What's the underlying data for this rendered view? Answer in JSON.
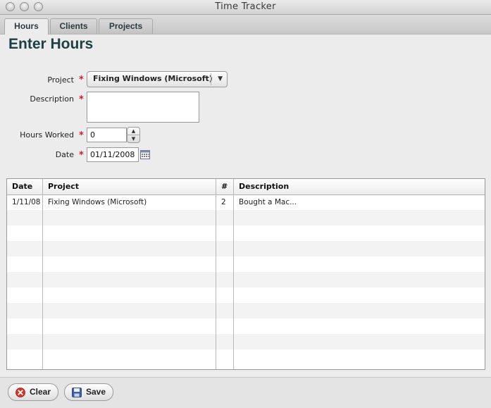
{
  "window": {
    "title": "Time Tracker"
  },
  "tabs": [
    {
      "label": "Hours",
      "active": true
    },
    {
      "label": "Clients",
      "active": false
    },
    {
      "label": "Projects",
      "active": false
    }
  ],
  "page": {
    "title": "Enter Hours"
  },
  "form": {
    "project": {
      "label": "Project",
      "value": "Fixing Windows (Microsoft)",
      "required_mark": "*"
    },
    "description": {
      "label": "Description",
      "value": "",
      "required_mark": "*"
    },
    "hours": {
      "label": "Hours Worked",
      "value": "0",
      "required_mark": "*"
    },
    "date": {
      "label": "Date",
      "value": "01/11/2008",
      "required_mark": "*"
    }
  },
  "table": {
    "columns": [
      "Date",
      "Project",
      "#",
      "Description"
    ],
    "rows": [
      {
        "date": "1/11/08",
        "project": "Fixing Windows (Microsoft)",
        "hours": "2",
        "description": "Bought a Mac..."
      }
    ]
  },
  "buttons": {
    "clear": "Clear",
    "save": "Save"
  },
  "colors": {
    "heading": "#1e3f44",
    "required": "#d0202a",
    "clear_icon": "#d03a2a",
    "save_icon": "#3a5ea8"
  }
}
